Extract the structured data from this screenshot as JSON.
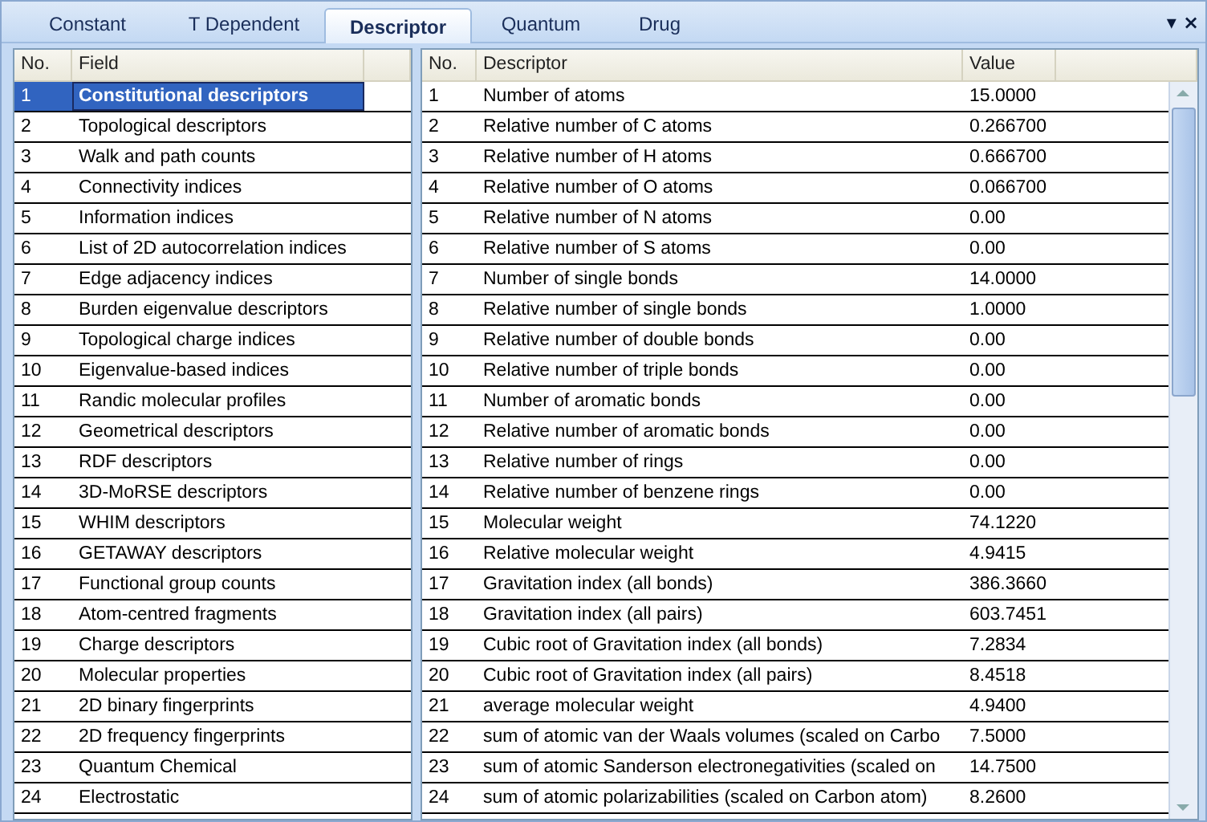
{
  "tabs": [
    {
      "label": "Constant",
      "selected": false
    },
    {
      "label": "T Dependent",
      "selected": false
    },
    {
      "label": "Descriptor",
      "selected": true
    },
    {
      "label": "Quantum",
      "selected": false
    },
    {
      "label": "Drug",
      "selected": false
    }
  ],
  "tab_controls": [
    "▾",
    "×"
  ],
  "field_table": {
    "columns": [
      "No.",
      "Field"
    ],
    "rows": [
      {
        "no": "1",
        "field": "Constitutional descriptors",
        "selected": true
      },
      {
        "no": "2",
        "field": "Topological descriptors",
        "selected": false
      },
      {
        "no": "3",
        "field": "Walk and path counts",
        "selected": false
      },
      {
        "no": "4",
        "field": "Connectivity indices",
        "selected": false
      },
      {
        "no": "5",
        "field": "Information indices",
        "selected": false
      },
      {
        "no": "6",
        "field": "List of 2D autocorrelation indices",
        "selected": false
      },
      {
        "no": "7",
        "field": "Edge adjacency indices",
        "selected": false
      },
      {
        "no": "8",
        "field": "Burden eigenvalue descriptors",
        "selected": false
      },
      {
        "no": "9",
        "field": "Topological charge indices",
        "selected": false
      },
      {
        "no": "10",
        "field": "Eigenvalue-based indices",
        "selected": false
      },
      {
        "no": "11",
        "field": "Randic molecular profiles",
        "selected": false
      },
      {
        "no": "12",
        "field": "Geometrical descriptors",
        "selected": false
      },
      {
        "no": "13",
        "field": "RDF descriptors",
        "selected": false
      },
      {
        "no": "14",
        "field": "3D-MoRSE descriptors",
        "selected": false
      },
      {
        "no": "15",
        "field": "WHIM descriptors",
        "selected": false
      },
      {
        "no": "16",
        "field": "GETAWAY descriptors",
        "selected": false
      },
      {
        "no": "17",
        "field": "Functional group counts",
        "selected": false
      },
      {
        "no": "18",
        "field": "Atom-centred fragments",
        "selected": false
      },
      {
        "no": "19",
        "field": "Charge descriptors",
        "selected": false
      },
      {
        "no": "20",
        "field": "Molecular properties",
        "selected": false
      },
      {
        "no": "21",
        "field": "2D binary fingerprints",
        "selected": false
      },
      {
        "no": "22",
        "field": "2D frequency fingerprints",
        "selected": false
      },
      {
        "no": "23",
        "field": "Quantum Chemical",
        "selected": false
      },
      {
        "no": "24",
        "field": "Electrostatic",
        "selected": false
      }
    ]
  },
  "descriptor_table": {
    "columns": [
      "No.",
      "Descriptor",
      "Value"
    ],
    "rows": [
      {
        "no": "1",
        "descriptor": "Number of atoms",
        "value": "15.0000"
      },
      {
        "no": "2",
        "descriptor": "Relative number of C atoms",
        "value": "0.266700"
      },
      {
        "no": "3",
        "descriptor": "Relative number of H atoms",
        "value": "0.666700"
      },
      {
        "no": "4",
        "descriptor": "Relative number of O atoms",
        "value": "0.066700"
      },
      {
        "no": "5",
        "descriptor": "Relative number of N atoms",
        "value": "0.00"
      },
      {
        "no": "6",
        "descriptor": "Relative number of S atoms",
        "value": "0.00"
      },
      {
        "no": "7",
        "descriptor": "Number of single bonds",
        "value": "14.0000"
      },
      {
        "no": "8",
        "descriptor": "Relative number of single bonds",
        "value": "1.0000"
      },
      {
        "no": "9",
        "descriptor": "Relative number of double bonds",
        "value": "0.00"
      },
      {
        "no": "10",
        "descriptor": "Relative number of triple bonds",
        "value": "0.00"
      },
      {
        "no": "11",
        "descriptor": "Number of aromatic bonds",
        "value": "0.00"
      },
      {
        "no": "12",
        "descriptor": "Relative number of aromatic bonds",
        "value": "0.00"
      },
      {
        "no": "13",
        "descriptor": "Relative number of rings",
        "value": "0.00"
      },
      {
        "no": "14",
        "descriptor": "Relative number of benzene rings",
        "value": "0.00"
      },
      {
        "no": "15",
        "descriptor": "Molecular weight",
        "value": "74.1220"
      },
      {
        "no": "16",
        "descriptor": "Relative molecular weight",
        "value": "4.9415"
      },
      {
        "no": "17",
        "descriptor": "Gravitation index (all bonds)",
        "value": "386.3660"
      },
      {
        "no": "18",
        "descriptor": "Gravitation index (all pairs)",
        "value": "603.7451"
      },
      {
        "no": "19",
        "descriptor": "Cubic root of Gravitation index (all bonds)",
        "value": "7.2834"
      },
      {
        "no": "20",
        "descriptor": "Cubic root of Gravitation index (all pairs)",
        "value": "8.4518"
      },
      {
        "no": "21",
        "descriptor": "average molecular weight",
        "value": "4.9400"
      },
      {
        "no": "22",
        "descriptor": "sum of atomic van der Waals volumes (scaled on Carbo",
        "value": "7.5000"
      },
      {
        "no": "23",
        "descriptor": "sum of atomic Sanderson electronegativities (scaled on",
        "value": "14.7500"
      },
      {
        "no": "24",
        "descriptor": "sum of atomic polarizabilities (scaled on Carbon atom)",
        "value": "8.2600"
      }
    ]
  }
}
